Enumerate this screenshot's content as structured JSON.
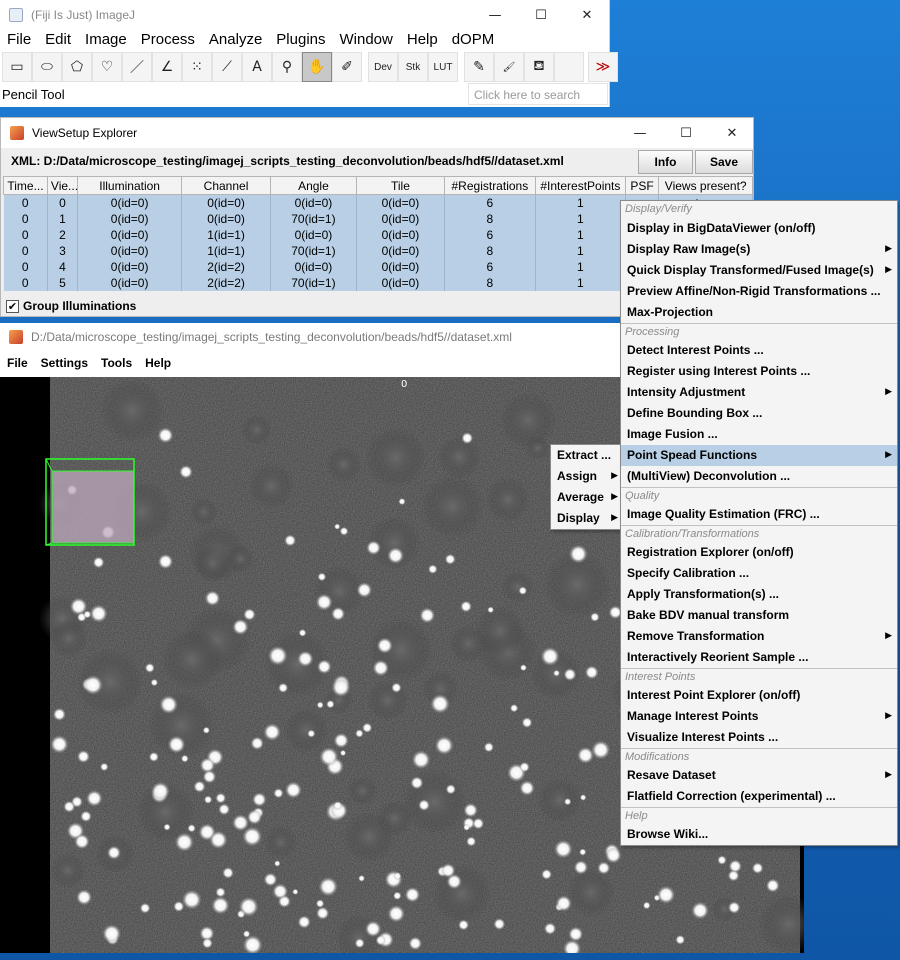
{
  "fiji": {
    "title": "(Fiji Is Just) ImageJ",
    "window_controls": [
      "—",
      "☐",
      "✕"
    ],
    "menu": [
      "File",
      "Edit",
      "Image",
      "Process",
      "Analyze",
      "Plugins",
      "Window",
      "Help",
      "dOPM"
    ],
    "tools": [
      {
        "name": "rectangle-tool",
        "glyph": "▭"
      },
      {
        "name": "oval-tool",
        "glyph": "⬭"
      },
      {
        "name": "polygon-tool",
        "glyph": "⬠"
      },
      {
        "name": "freehand-tool",
        "glyph": "♡"
      },
      {
        "name": "line-tool",
        "glyph": "／"
      },
      {
        "name": "angle-tool",
        "glyph": "∠"
      },
      {
        "name": "multipoint-tool",
        "glyph": "⁙"
      },
      {
        "name": "wand-tool",
        "glyph": "⟋"
      },
      {
        "name": "text-tool",
        "glyph": "A"
      },
      {
        "name": "magnifier-tool",
        "glyph": "⚲"
      },
      {
        "name": "hand-tool",
        "glyph": "✋"
      },
      {
        "name": "color-picker-tool",
        "glyph": "✐"
      },
      {
        "name": "dev-tool",
        "glyph": "Dev"
      },
      {
        "name": "stk-tool",
        "glyph": "Stk"
      },
      {
        "name": "lut-tool",
        "glyph": "LUT"
      },
      {
        "name": "pencil-tool",
        "glyph": "✎"
      },
      {
        "name": "brush-tool",
        "glyph": "🖌"
      },
      {
        "name": "flood-fill-tool",
        "glyph": "⛾"
      },
      {
        "name": "empty-tool-slot",
        "glyph": ""
      },
      {
        "name": "more-tools",
        "glyph": "≫"
      }
    ],
    "status": "Pencil Tool",
    "search_placeholder": "Click here to search"
  },
  "viewsetup": {
    "title": "ViewSetup Explorer",
    "xml_path": "XML: D:/Data/microscope_testing/imagej_scripts_testing_deconvolution/beads/hdf5//dataset.xml",
    "info_label": "Info",
    "save_label": "Save",
    "columns": [
      "Time...",
      "Vie...",
      "Illumination",
      "Channel",
      "Angle",
      "Tile",
      "#Registrations",
      "#InterestPoints",
      "PSF",
      "Views present?"
    ],
    "rows": [
      [
        "0",
        "0",
        "0(id=0)",
        "0(id=0)",
        "0(id=0)",
        "0(id=0)",
        "6",
        "1",
        "",
        "true"
      ],
      [
        "0",
        "1",
        "0(id=0)",
        "0(id=0)",
        "70(id=1)",
        "0(id=0)",
        "8",
        "1",
        "",
        ""
      ],
      [
        "0",
        "2",
        "0(id=0)",
        "1(id=1)",
        "0(id=0)",
        "0(id=0)",
        "6",
        "1",
        "",
        ""
      ],
      [
        "0",
        "3",
        "0(id=0)",
        "1(id=1)",
        "70(id=1)",
        "0(id=0)",
        "8",
        "1",
        "",
        ""
      ],
      [
        "0",
        "4",
        "0(id=0)",
        "2(id=2)",
        "0(id=0)",
        "0(id=0)",
        "6",
        "1",
        "",
        ""
      ],
      [
        "0",
        "5",
        "0(id=0)",
        "2(id=2)",
        "70(id=1)",
        "0(id=0)",
        "8",
        "1",
        "",
        ""
      ]
    ],
    "group_label": "Group Illuminations"
  },
  "bdv": {
    "title": "D:/Data/microscope_testing/imagej_scripts_testing_deconvolution/beads/hdf5//dataset.xml",
    "menu": [
      "File",
      "Settings",
      "Tools",
      "Help"
    ],
    "timepoint": "0"
  },
  "context_menu": {
    "sections": [
      {
        "header": "Display/Verify",
        "items": [
          {
            "label": "Display in BigDataViewer (on/off)",
            "submenu": false
          },
          {
            "label": "Display Raw Image(s)",
            "submenu": true
          },
          {
            "label": "Quick Display Transformed/Fused Image(s)",
            "submenu": true
          },
          {
            "label": "Preview Affine/Non-Rigid Transformations ...",
            "submenu": false
          },
          {
            "label": "Max-Projection",
            "submenu": false
          }
        ]
      },
      {
        "header": "Processing",
        "items": [
          {
            "label": "Detect Interest Points ...",
            "submenu": false
          },
          {
            "label": "Register using Interest Points ...",
            "submenu": false
          },
          {
            "label": "Intensity Adjustment",
            "submenu": true
          },
          {
            "label": "Define Bounding Box ...",
            "submenu": false
          },
          {
            "label": "Image Fusion ...",
            "submenu": false
          },
          {
            "label": "Point Spead Functions",
            "submenu": true,
            "selected": true
          },
          {
            "label": "(MultiView) Deconvolution ...",
            "submenu": false
          }
        ]
      },
      {
        "header": "Quality",
        "items": [
          {
            "label": "Image Quality Estimation (FRC) ...",
            "submenu": false
          }
        ]
      },
      {
        "header": "Calibration/Transformations",
        "items": [
          {
            "label": "Registration Explorer (on/off)",
            "submenu": false
          },
          {
            "label": "Specify Calibration ...",
            "submenu": false
          },
          {
            "label": "Apply Transformation(s) ...",
            "submenu": false
          },
          {
            "label": "Bake BDV manual transform",
            "submenu": false
          },
          {
            "label": "Remove Transformation",
            "submenu": true
          },
          {
            "label": "Interactively Reorient Sample ...",
            "submenu": false
          }
        ]
      },
      {
        "header": "Interest Points",
        "items": [
          {
            "label": "Interest Point Explorer (on/off)",
            "submenu": false
          },
          {
            "label": "Manage Interest Points",
            "submenu": true
          },
          {
            "label": "Visualize Interest Points ...",
            "submenu": false
          }
        ]
      },
      {
        "header": "Modifications",
        "items": [
          {
            "label": "Resave Dataset",
            "submenu": true
          },
          {
            "label": "Flatfield Correction (experimental) ...",
            "submenu": false
          }
        ]
      },
      {
        "header": "Help",
        "items": [
          {
            "label": "Browse Wiki...",
            "submenu": false
          }
        ]
      }
    ]
  },
  "psf_submenu": {
    "items": [
      {
        "label": "Extract ...",
        "submenu": false
      },
      {
        "label": "Assign",
        "submenu": true
      },
      {
        "label": "Average",
        "submenu": true
      },
      {
        "label": "Display",
        "submenu": true
      }
    ]
  },
  "colors": {
    "selection_blue": "#b8cfe5",
    "desktop_blue": "#1665b9",
    "bounding_box_green": "#2bff2b"
  }
}
